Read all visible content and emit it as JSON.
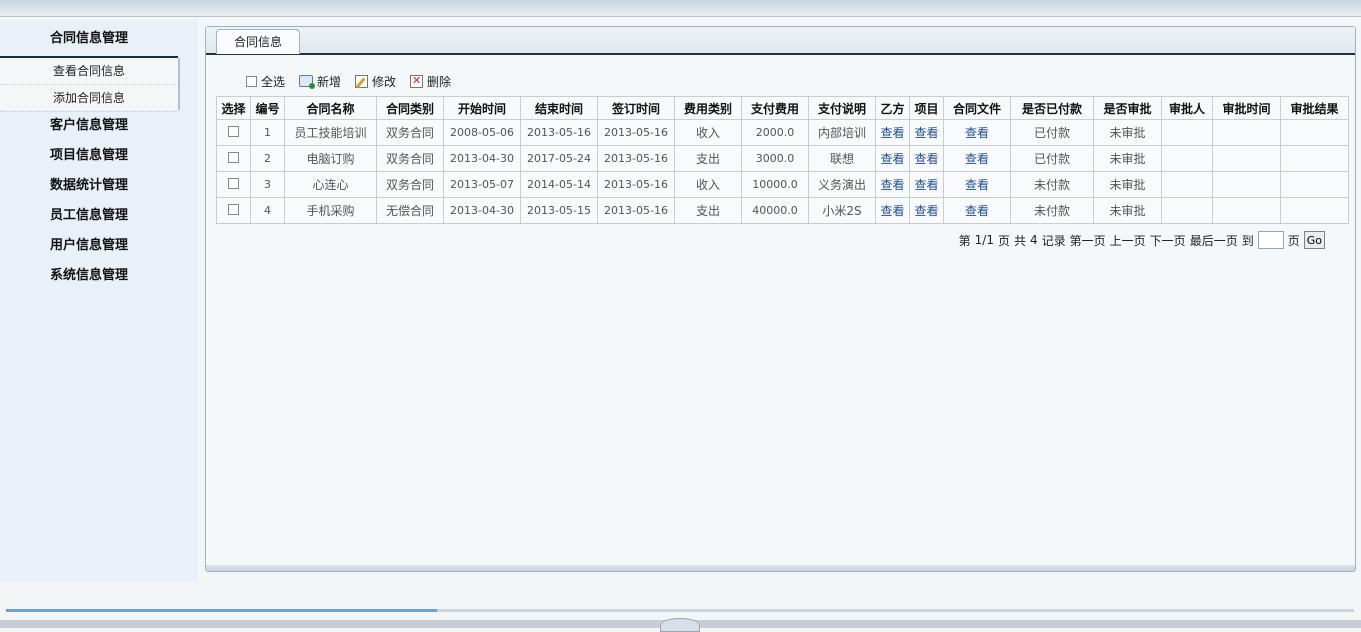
{
  "sidebar": {
    "main_title": "合同信息管理",
    "sub_items": [
      "查看合同信息",
      "添加合同信息"
    ],
    "menu_items": [
      "客户信息管理",
      "项目信息管理",
      "数据统计管理",
      "员工信息管理",
      "用户信息管理",
      "系统信息管理"
    ]
  },
  "tab": {
    "label": "合同信息"
  },
  "toolbar": {
    "select_all": "全选",
    "add": "新增",
    "edit": "修改",
    "delete": "删除"
  },
  "table": {
    "headers": [
      "选择",
      "编号",
      "合同名称",
      "合同类别",
      "开始时间",
      "结束时间",
      "签订时间",
      "费用类别",
      "支付费用",
      "支付说明",
      "乙方",
      "项目",
      "合同文件",
      "是否已付款",
      "是否审批",
      "审批人",
      "审批时间",
      "审批结果"
    ],
    "rows": [
      {
        "id": "1",
        "name": "员工技能培训",
        "category": "双务合同",
        "start": "2008-05-06",
        "end": "2013-05-16",
        "signed": "2013-05-16",
        "fee_type": "收入",
        "fee": "2000.0",
        "fee_note": "内部培训",
        "party_b": "查看",
        "project": "查看",
        "file": "查看",
        "paid": "已付款",
        "approved": "未审批",
        "approver": "",
        "approve_time": "",
        "approve_result": ""
      },
      {
        "id": "2",
        "name": "电脑订购",
        "category": "双务合同",
        "start": "2013-04-30",
        "end": "2017-05-24",
        "signed": "2013-05-16",
        "fee_type": "支出",
        "fee": "3000.0",
        "fee_note": "联想",
        "party_b": "查看",
        "project": "查看",
        "file": "查看",
        "paid": "已付款",
        "approved": "未审批",
        "approver": "",
        "approve_time": "",
        "approve_result": ""
      },
      {
        "id": "3",
        "name": "心连心",
        "category": "双务合同",
        "start": "2013-05-07",
        "end": "2014-05-14",
        "signed": "2013-05-16",
        "fee_type": "收入",
        "fee": "10000.0",
        "fee_note": "义务演出",
        "party_b": "查看",
        "project": "查看",
        "file": "查看",
        "paid": "未付款",
        "approved": "未审批",
        "approver": "",
        "approve_time": "",
        "approve_result": ""
      },
      {
        "id": "4",
        "name": "手机采购",
        "category": "无偿合同",
        "start": "2013-04-30",
        "end": "2013-05-15",
        "signed": "2013-05-16",
        "fee_type": "支出",
        "fee": "40000.0",
        "fee_note": "小米2S",
        "party_b": "查看",
        "project": "查看",
        "file": "查看",
        "paid": "未付款",
        "approved": "未审批",
        "approver": "",
        "approve_time": "",
        "approve_result": ""
      }
    ]
  },
  "pager": {
    "prefix": "第",
    "page": "1/1",
    "page_unit": "页",
    "total_prefix": "共",
    "total": "4",
    "total_unit": "记录",
    "first": "第一页",
    "prev": "上一页",
    "next": "下一页",
    "last": "最后一页",
    "goto_prefix": "到",
    "goto_unit": "页",
    "goto_value": "",
    "go_button": "Go"
  },
  "progress": {
    "fraction": 0.32
  },
  "colors": {
    "link": "#1f4f9a",
    "sidebar_bg": "#e9f0f8",
    "panel_border": "#9db3c2"
  }
}
